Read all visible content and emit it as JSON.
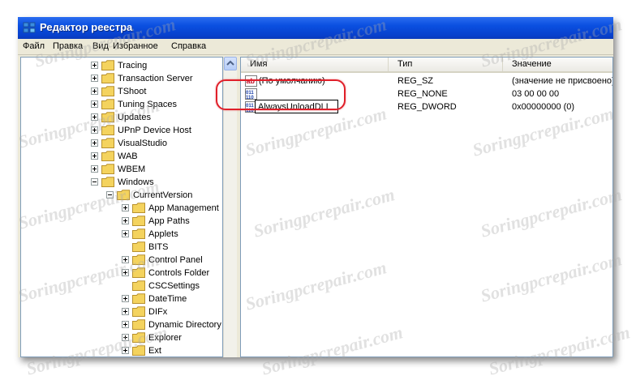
{
  "window": {
    "title": "Редактор реестра"
  },
  "menu": [
    "Файл",
    "Правка",
    "Вид",
    "Избранное",
    "Справка"
  ],
  "tree": {
    "items": [
      {
        "label": "Tracing",
        "depth": 0,
        "expander": "plus"
      },
      {
        "label": "Transaction Server",
        "depth": 0,
        "expander": "plus"
      },
      {
        "label": "TShoot",
        "depth": 0,
        "expander": "plus"
      },
      {
        "label": "Tuning Spaces",
        "depth": 0,
        "expander": "plus"
      },
      {
        "label": "Updates",
        "depth": 0,
        "expander": "plus"
      },
      {
        "label": "UPnP Device Host",
        "depth": 0,
        "expander": "plus"
      },
      {
        "label": "VisualStudio",
        "depth": 0,
        "expander": "plus"
      },
      {
        "label": "WAB",
        "depth": 0,
        "expander": "plus"
      },
      {
        "label": "WBEM",
        "depth": 0,
        "expander": "plus"
      },
      {
        "label": "Windows",
        "depth": 0,
        "expander": "minus"
      },
      {
        "label": "CurrentVersion",
        "depth": 1,
        "expander": "minus"
      },
      {
        "label": "App Management",
        "depth": 2,
        "expander": "plus"
      },
      {
        "label": "App Paths",
        "depth": 2,
        "expander": "plus"
      },
      {
        "label": "Applets",
        "depth": 2,
        "expander": "plus"
      },
      {
        "label": "BITS",
        "depth": 2,
        "expander": "none"
      },
      {
        "label": "Control Panel",
        "depth": 2,
        "expander": "plus"
      },
      {
        "label": "Controls Folder",
        "depth": 2,
        "expander": "plus"
      },
      {
        "label": "CSCSettings",
        "depth": 2,
        "expander": "none"
      },
      {
        "label": "DateTime",
        "depth": 2,
        "expander": "plus"
      },
      {
        "label": "DIFx",
        "depth": 2,
        "expander": "plus"
      },
      {
        "label": "Dynamic Directory",
        "depth": 2,
        "expander": "plus"
      },
      {
        "label": "Explorer",
        "depth": 2,
        "expander": "plus"
      },
      {
        "label": "Ext",
        "depth": 2,
        "expander": "plus"
      }
    ]
  },
  "list": {
    "columns": [
      "Имя",
      "Тип",
      "Значение"
    ],
    "rows": [
      {
        "name": "(По умолчанию)",
        "type": "REG_SZ",
        "value": "(значение не присвоено)",
        "icon": "string-value-icon"
      },
      {
        "name": "",
        "type": "REG_NONE",
        "value": "03 00 00 00",
        "icon": "binary-value-icon"
      },
      {
        "name": "",
        "type": "REG_DWORD",
        "value": "0x00000000 (0)",
        "icon": "binary-value-icon"
      }
    ],
    "edit_value": "AlwaysUnloadDLL"
  },
  "watermark": "Soringpcrepair.com",
  "colors": {
    "titlebar": "#0a4fe0",
    "highlight": "#e0202a",
    "folder": "#f4d35e"
  }
}
